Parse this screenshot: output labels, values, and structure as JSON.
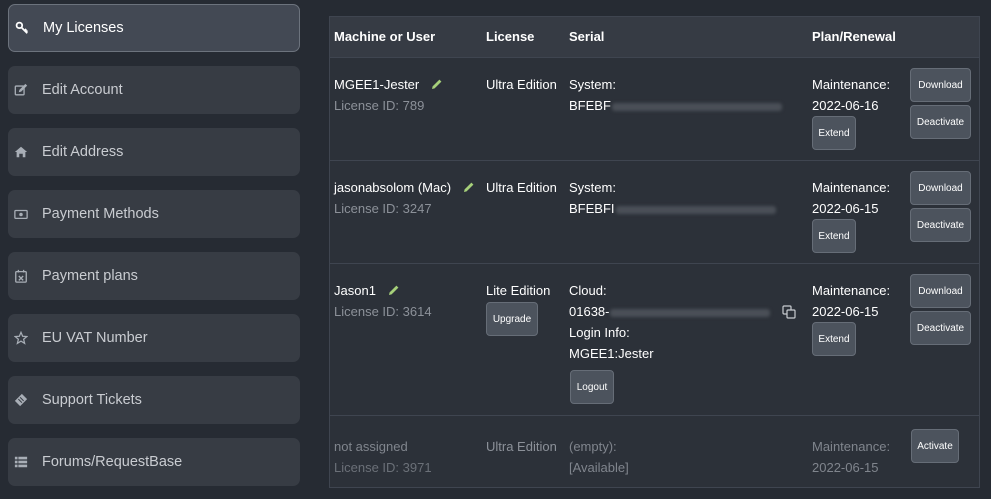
{
  "sidebar": {
    "items": [
      {
        "label": "My Licenses",
        "icon": "key-icon",
        "active": true
      },
      {
        "label": "Edit Account",
        "icon": "edit-icon"
      },
      {
        "label": "Edit Address",
        "icon": "home-icon"
      },
      {
        "label": "Payment Methods",
        "icon": "money-icon"
      },
      {
        "label": "Payment plans",
        "icon": "calendar-icon"
      },
      {
        "label": "EU VAT Number",
        "icon": "star-icon"
      },
      {
        "label": "Support Tickets",
        "icon": "ticket-icon"
      },
      {
        "label": "Forums/RequestBase",
        "icon": "list-icon"
      }
    ]
  },
  "table": {
    "headers": {
      "machine": "Machine or User",
      "license": "License",
      "serial": "Serial",
      "plan": "Plan/Renewal"
    },
    "rows": [
      {
        "machine": "MGEE1-Jester",
        "license_id": "License ID: 789",
        "license": "Ultra Edition",
        "serial_label": "System:",
        "serial_value": "BFEBF",
        "plan_label": "Maintenance:",
        "plan_date": "2022-06-16",
        "extend": "Extend",
        "download": "Download",
        "deactivate": "Deactivate"
      },
      {
        "machine": "jasonabsolom (Mac)",
        "license_id": "License ID: 3247",
        "license": "Ultra Edition",
        "serial_label": "System:",
        "serial_value": "BFEBFI",
        "plan_label": "Maintenance:",
        "plan_date": "2022-06-15",
        "extend": "Extend",
        "download": "Download",
        "deactivate": "Deactivate"
      },
      {
        "machine": "Jason1",
        "license_id": "License ID: 3614",
        "license": "Lite Edition",
        "upgrade": "Upgrade",
        "serial_label": "Cloud:",
        "serial_value": "01638-",
        "login_label": "Login Info:",
        "login_value": "MGEE1:Jester",
        "logout": "Logout",
        "plan_label": "Maintenance:",
        "plan_date": "2022-06-15",
        "extend": "Extend",
        "download": "Download",
        "deactivate": "Deactivate"
      },
      {
        "machine": "not assigned",
        "license_id": "License ID: 3971",
        "license": "Ultra Edition",
        "serial_label": "(empty):",
        "serial_value": "[Available]",
        "plan_label": "Maintenance:",
        "plan_date": "2022-06-15",
        "activate": "Activate"
      }
    ]
  },
  "colors": {
    "background": "#262b33",
    "sidebar_item": "#373c44",
    "table_header": "#363b44",
    "button": "#4c535d",
    "pencil": "#a6d07a"
  }
}
